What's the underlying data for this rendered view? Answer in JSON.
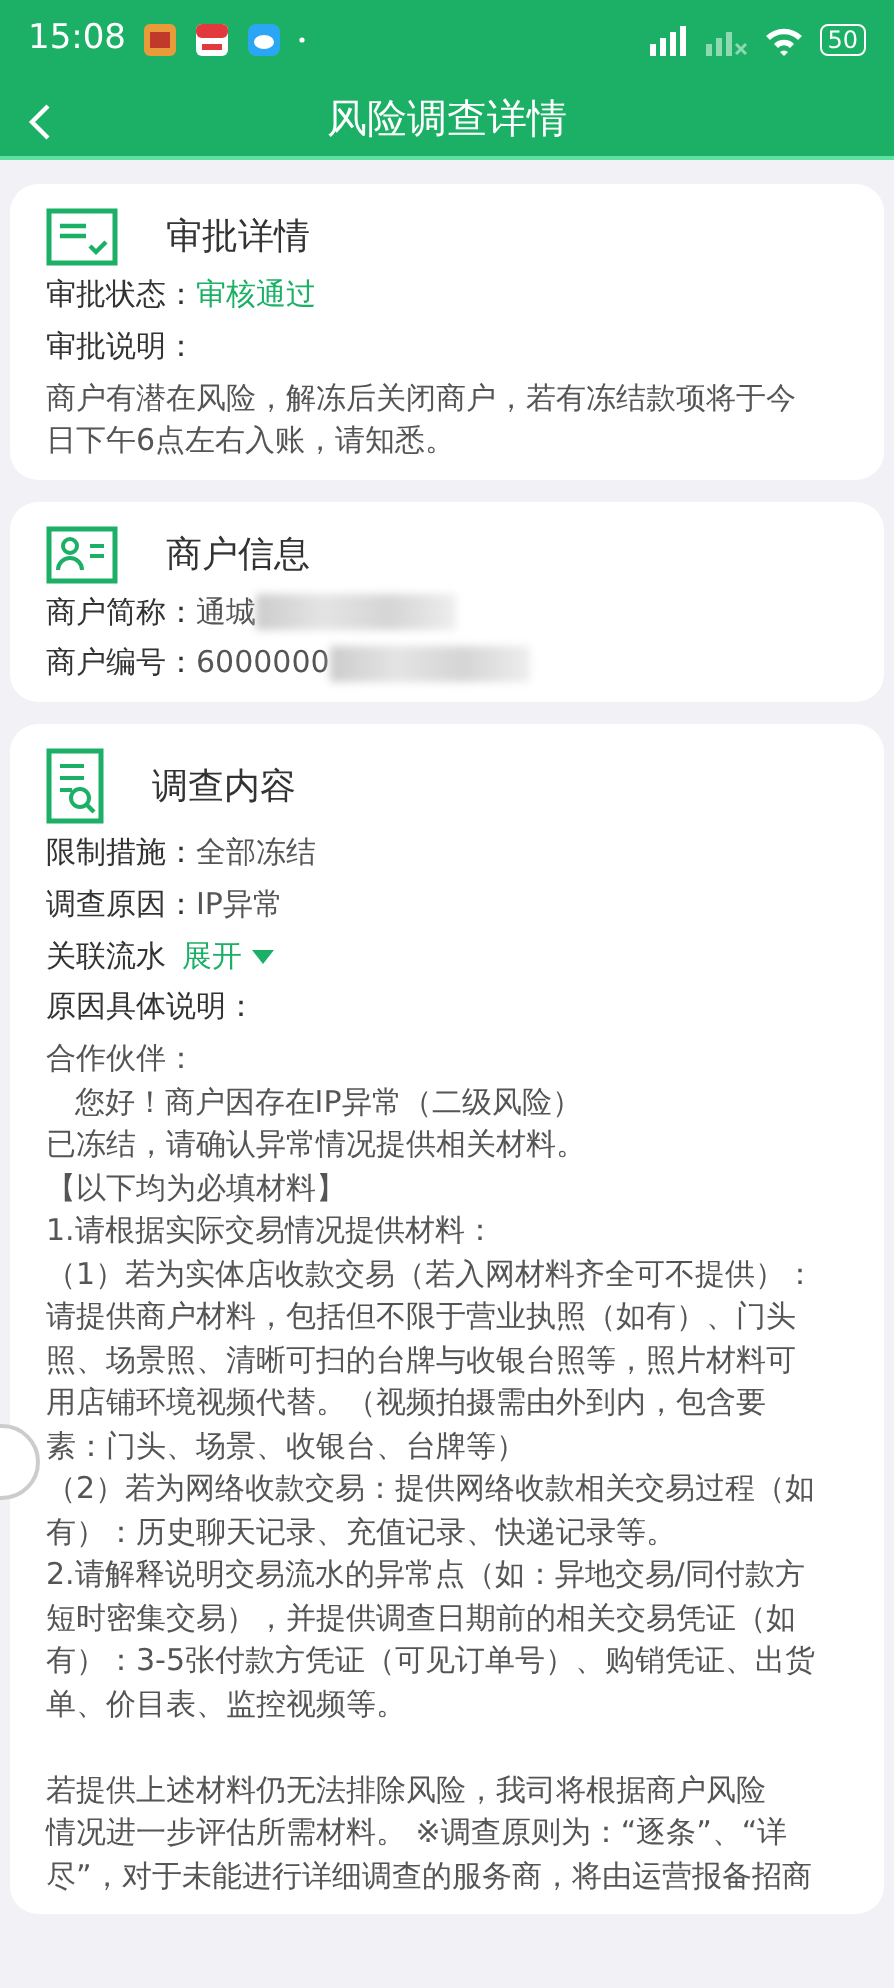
{
  "status_bar": {
    "time": "15:08",
    "battery": "50"
  },
  "header": {
    "title": "风险调查详情"
  },
  "sections": [
    {
      "kind": "approval",
      "title": "审批详情",
      "rows": [
        {
          "kind": "field",
          "label": "审批状态：",
          "value": "审核通过",
          "highlight": true
        },
        {
          "kind": "label",
          "label": "审批说明："
        },
        {
          "kind": "paragraphs",
          "paragraphs": [
            [
              "商户有潜在风险，解冻后关闭商户，若有冻结款项将于今",
              "日下午6点左右入账，请知悉。"
            ]
          ]
        }
      ]
    },
    {
      "kind": "merchant",
      "title": "商户信息",
      "rows": [
        {
          "kind": "field",
          "label": "商户简称：",
          "value": "通城",
          "highlight": false,
          "masked": true
        },
        {
          "kind": "field",
          "label": "商户编号：",
          "value": "6000000",
          "highlight": false,
          "masked": true
        }
      ]
    },
    {
      "kind": "investigation",
      "title": "调查内容",
      "rows": [
        {
          "kind": "field",
          "label": "限制措施：",
          "value": "全部冻结",
          "highlight": false
        },
        {
          "kind": "field",
          "label": "调查原因：",
          "value": "IP异常",
          "highlight": false
        },
        {
          "kind": "toggle",
          "label": "关联流水",
          "action": "展开",
          "expanded": false
        },
        {
          "kind": "label",
          "label": "原因具体说明："
        },
        {
          "kind": "paragraphs",
          "paragraphs": [
            [
              "合作伙伴：",
              "   您好！商户因存在IP异常（二级风险）",
              "已冻结，请确认异常情况提供相关材料。",
              "【以下均为必填材料】",
              "1.请根据实际交易情况提供材料：",
              "（1）若为实体店收款交易（若入网材料齐全可不提供）：",
              "请提供商户材料，包括但不限于营业执照（如有）、门头",
              "照、场景照、清晰可扫的台牌与收银台照等，照片材料可",
              "用店铺环境视频代替。（视频拍摄需由外到内，包含要",
              "素：门头、场景、收银台、台牌等）",
              "（2）若为网络收款交易：提供网络收款相关交易过程（如",
              "有）：历史聊天记录、充值记录、快递记录等。",
              "2.请解释说明交易流水的异常点（如：异地交易/同付款方",
              "短时密集交易），并提供调查日期前的相关交易凭证（如",
              "有）：3-5张付款方凭证（可见订单号）、购销凭证、出货",
              "单、价目表、监控视频等。"
            ],
            [
              "若提供上述材料仍无法排除风险，我司将根据商户风险",
              "情况进一步评估所需材料。 ※调查原则为：“逐条”、“详",
              "尽”，对于未能进行详细调查的服务商，将由运营报备招商"
            ]
          ]
        }
      ]
    }
  ]
}
